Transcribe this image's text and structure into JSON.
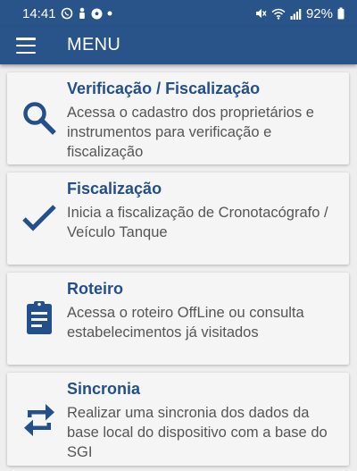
{
  "status_bar": {
    "time": "14:41",
    "battery": "92%",
    "icons": [
      "whatsapp-icon",
      "notification-icon",
      "soccer-icon",
      "dot-icon",
      "mute-icon",
      "wifi-icon",
      "signal-icon",
      "battery-icon"
    ]
  },
  "app_bar": {
    "title": "MENU",
    "menu_icon": "hamburger-icon"
  },
  "menu": {
    "items": [
      {
        "title": "Verificação / Fiscalização",
        "description": "Acessa o cadastro dos proprietários e instrumentos para verificação e fiscalização",
        "icon": "search-icon"
      },
      {
        "title": "Fiscalização",
        "description": "Inicia a fiscalização de Cronotacógrafo / Veículo Tanque",
        "icon": "check-icon"
      },
      {
        "title": "Roteiro",
        "description": "Acessa o roteiro OffLine ou consulta estabelecimentos já visitados",
        "icon": "clipboard-icon"
      },
      {
        "title": "Sincronia",
        "description": "Realizar uma sincronia dos dados da base local do dispositivo com a base do SGI",
        "icon": "sync-icon"
      }
    ]
  },
  "colors": {
    "primary": "#285489",
    "accent": "#23508a",
    "card_background": "#f5f5f5",
    "page_background": "#eeeeee",
    "description_text": "#555555"
  }
}
